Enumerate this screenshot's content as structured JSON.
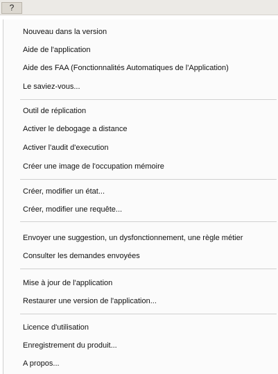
{
  "menubar": {
    "help_label": "?"
  },
  "menu": {
    "group1": [
      {
        "label": "Nouveau dans la version"
      },
      {
        "label": "Aide de l'application"
      },
      {
        "label": "Aide des FAA (Fonctionnalités Automatiques de l'Application)"
      },
      {
        "label": "Le saviez-vous..."
      }
    ],
    "group2": [
      {
        "label": "Outil de réplication"
      },
      {
        "label": "Activer le debogage a distance"
      },
      {
        "label": "Activer l'audit d'execution"
      },
      {
        "label": "Créer une image de l'occupation mémoire"
      }
    ],
    "group3": [
      {
        "label": "Créer, modifier un état..."
      },
      {
        "label": "Créer, modifier une requête..."
      }
    ],
    "group4": [
      {
        "label": "Envoyer une suggestion, un dysfonctionnement, une règle métier"
      },
      {
        "label": "Consulter les demandes envoyées"
      }
    ],
    "group5": [
      {
        "label": "Mise à jour de l'application"
      },
      {
        "label": "Restaurer une version de l'application..."
      }
    ],
    "group6": [
      {
        "label": "Licence d'utilisation"
      },
      {
        "label": "Enregistrement du produit..."
      },
      {
        "label": "A propos..."
      }
    ]
  }
}
